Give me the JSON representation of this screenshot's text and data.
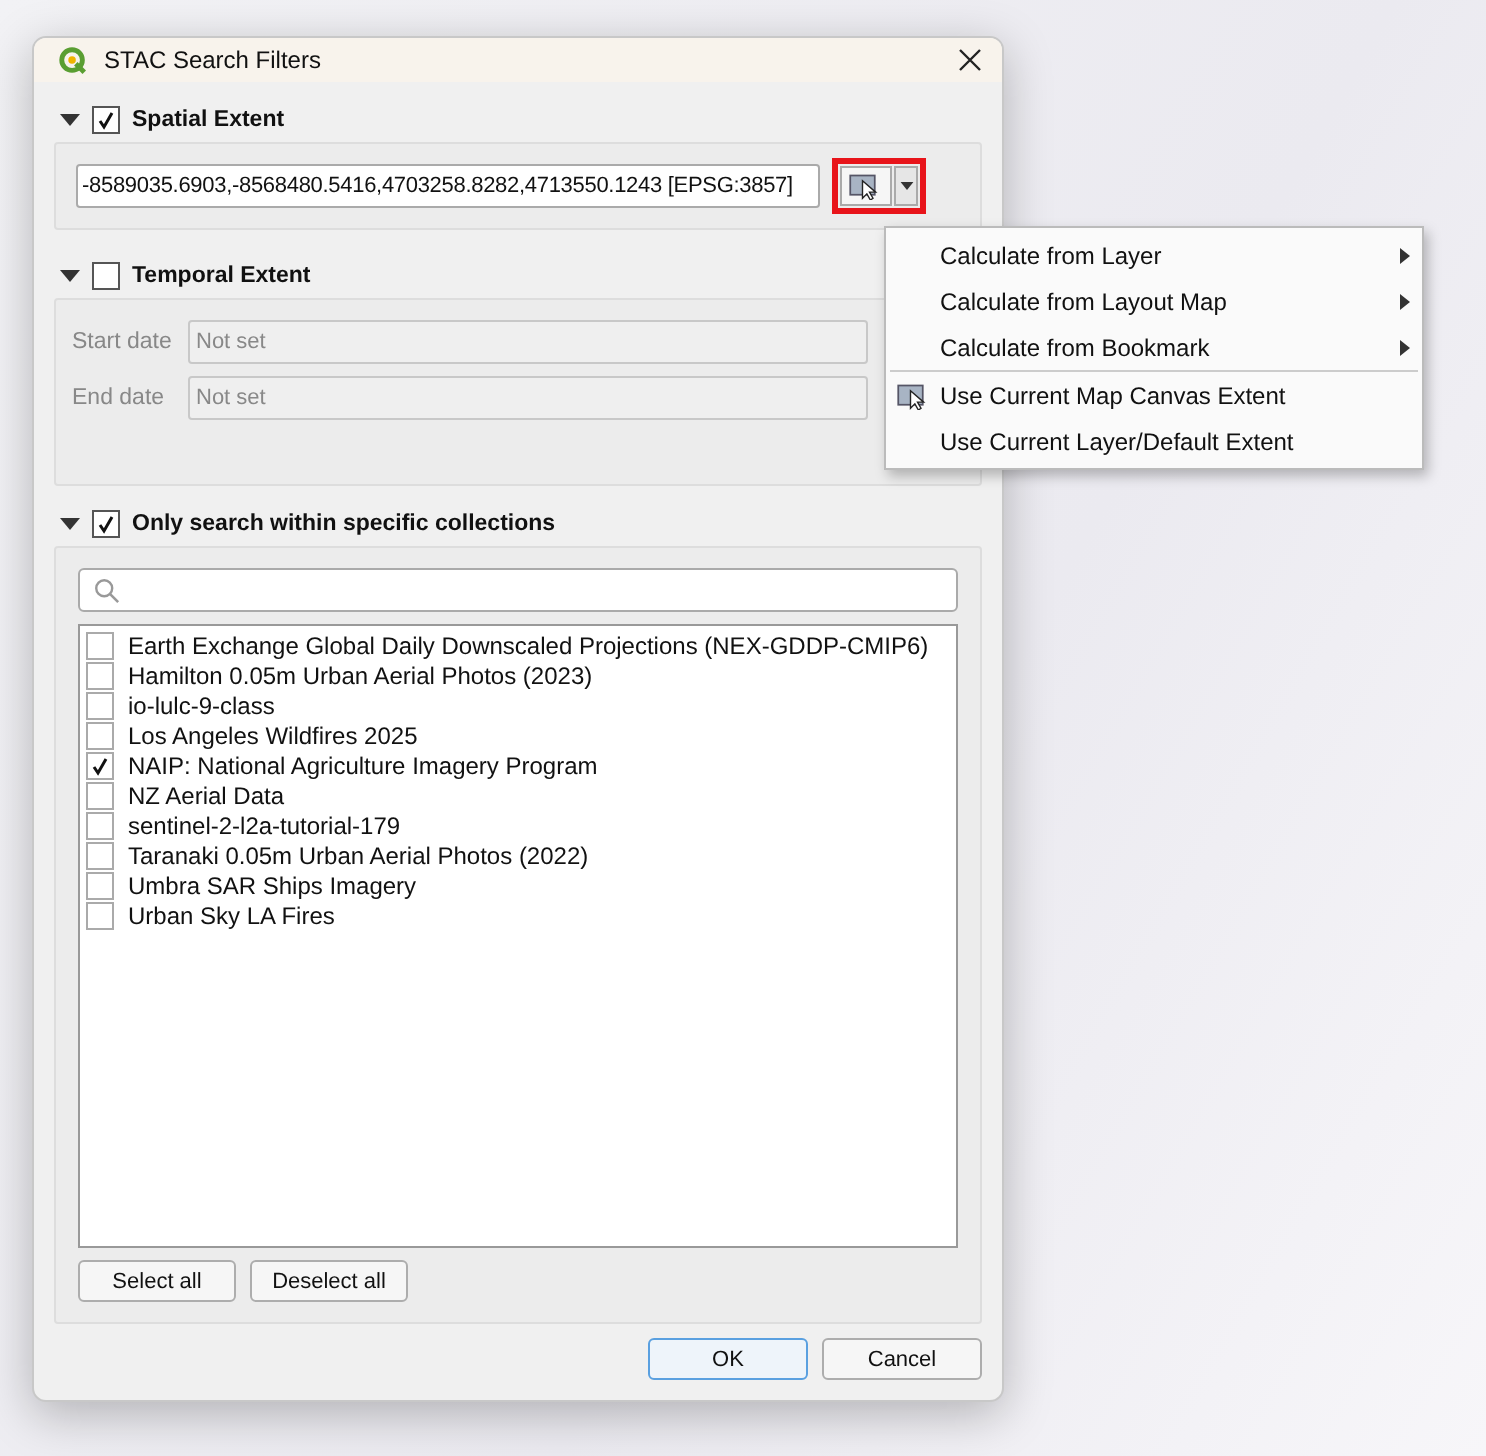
{
  "window": {
    "title": "STAC Search Filters"
  },
  "spatial": {
    "title": "Spatial Extent",
    "expanded": true,
    "checked": true,
    "extent_value": "-8589035.6903,-8568480.5416,4703258.8282,4713550.1243 [EPSG:3857]"
  },
  "temporal": {
    "title": "Temporal Extent",
    "expanded": true,
    "checked": false,
    "fields": [
      {
        "label": "Start date",
        "value": "Not set"
      },
      {
        "label": "End date",
        "value": "Not set"
      }
    ]
  },
  "collections": {
    "title": "Only search within specific collections",
    "expanded": true,
    "checked": true,
    "items": [
      {
        "label": "Earth Exchange Global Daily Downscaled Projections (NEX-GDDP-CMIP6)",
        "checked": false
      },
      {
        "label": "Hamilton 0.05m Urban Aerial Photos (2023)",
        "checked": false
      },
      {
        "label": "io-lulc-9-class",
        "checked": false
      },
      {
        "label": "Los Angeles Wildfires 2025",
        "checked": false
      },
      {
        "label": "NAIP: National Agriculture Imagery Program",
        "checked": true
      },
      {
        "label": "NZ Aerial Data",
        "checked": false
      },
      {
        "label": "sentinel-2-l2a-tutorial-179",
        "checked": false
      },
      {
        "label": "Taranaki 0.05m Urban Aerial Photos (2022)",
        "checked": false
      },
      {
        "label": "Umbra SAR Ships Imagery",
        "checked": false
      },
      {
        "label": "Urban Sky LA Fires",
        "checked": false
      }
    ],
    "buttons": [
      "Select all",
      "Deselect all"
    ]
  },
  "buttons": [
    {
      "label": "OK",
      "kind": "default"
    },
    {
      "label": "Cancel",
      "kind": "normal"
    }
  ],
  "menu": {
    "items": [
      {
        "label": "Calculate from Layer",
        "kind": "submenu",
        "separator_before": false
      },
      {
        "label": "Calculate from Layout Map",
        "kind": "submenu",
        "separator_before": false
      },
      {
        "label": "Calculate from Bookmark",
        "kind": "submenu",
        "separator_before": false
      },
      {
        "label": "Use Current Map Canvas Extent",
        "kind": "canvas",
        "separator_before": true
      },
      {
        "label": "Use Current Layer/Default Extent",
        "kind": "action",
        "separator_before": false
      }
    ]
  }
}
